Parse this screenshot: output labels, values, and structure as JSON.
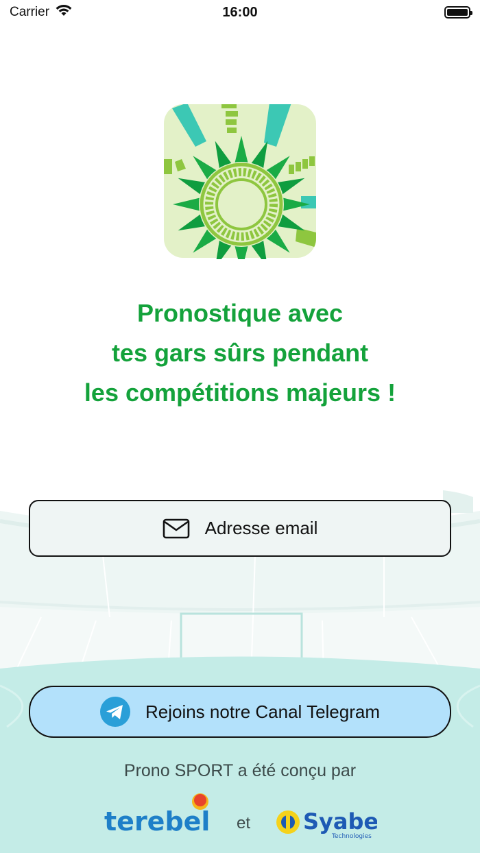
{
  "status_bar": {
    "carrier": "Carrier",
    "time": "16:00"
  },
  "tagline": {
    "line1": "Pronostique avec",
    "line2": "tes gars sûrs pendant",
    "line3": "les compétitions majeurs !"
  },
  "email_button": {
    "label": "Adresse email",
    "icon": "envelope-icon"
  },
  "telegram_button": {
    "label": "Rejoins notre Canal Telegram",
    "icon": "telegram-icon"
  },
  "credits": {
    "text": "Prono SPORT a été conçu par",
    "partners": [
      {
        "name": "terebel",
        "logo": "terebel-logo"
      },
      {
        "name": "Syabe",
        "subtitle": "Technologies",
        "logo": "syabe-logo"
      }
    ],
    "separator": "et"
  },
  "colors": {
    "brand_green": "#14a23b",
    "email_button_bg": "#eff5f4",
    "telegram_button_bg": "#b3e1fb",
    "field_bg": "#c4ece7",
    "terebel_blue": "#1e7fc8",
    "syabe_blue": "#1e5ab4"
  }
}
